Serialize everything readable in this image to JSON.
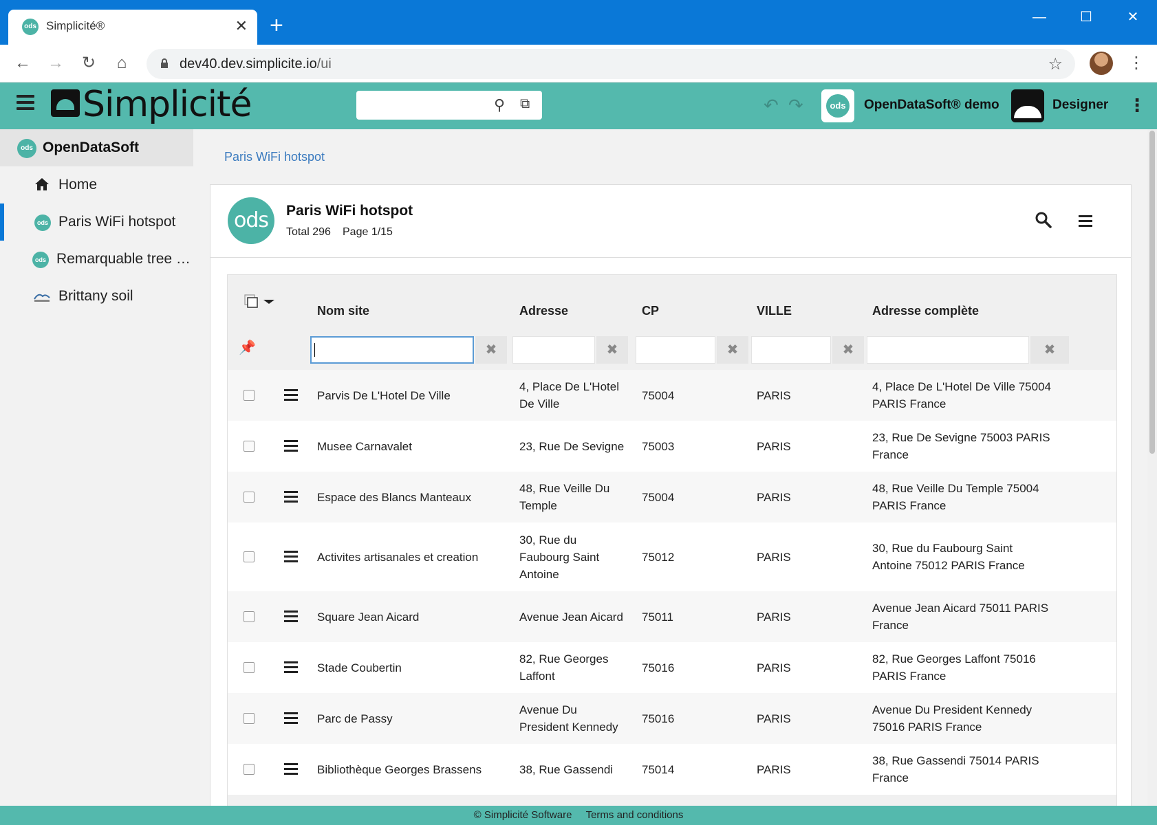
{
  "browser": {
    "tab_title": "Simplicité®",
    "tab_favicon_text": "ods",
    "url_host": "dev40.dev.simplicite.io",
    "url_path": "/ui",
    "colors": {
      "titlebar": "#0a78d7"
    }
  },
  "header": {
    "logo_text": "Simplicité",
    "scope_logo_text": "ods",
    "scope_name": "OpenDataSoft® demo",
    "user_name": "Designer",
    "colors": {
      "accent": "#54b9ad"
    }
  },
  "sidebar": {
    "group_label": "OpenDataSoft",
    "group_icon_text": "ods",
    "items": [
      {
        "label": "Home",
        "icon": "home-icon"
      },
      {
        "label": "Paris WiFi hotspot",
        "icon": "ods-icon",
        "icon_text": "ods",
        "active": true
      },
      {
        "label": "Remarquable tree …",
        "icon": "ods-icon",
        "icon_text": "ods"
      },
      {
        "label": "Brittany soil",
        "icon": "soil-icon"
      }
    ]
  },
  "main": {
    "breadcrumb": "Paris WiFi hotspot",
    "object_logo_text": "ods",
    "title": "Paris WiFi hotspot",
    "total": "Total 296",
    "page": "Page 1/15",
    "columns": [
      "Nom site",
      "Adresse",
      "CP",
      "VILLE",
      "Adresse complète"
    ],
    "filter_clear_glyph": "✖",
    "rows": [
      {
        "nom": "Parvis De L'Hotel De Ville",
        "adresse": [
          "4, Place De L'Hotel",
          "De Ville"
        ],
        "cp": "75004",
        "ville": "PARIS",
        "complete": [
          "4, Place De L'Hotel De Ville 75004",
          "PARIS France"
        ]
      },
      {
        "nom": "Musee Carnavalet",
        "adresse": [
          "23, Rue De Sevigne"
        ],
        "cp": "75003",
        "ville": "PARIS",
        "complete": [
          "23, Rue De Sevigne 75003 PARIS",
          "France"
        ]
      },
      {
        "nom": "Espace des Blancs Manteaux",
        "adresse": [
          "48, Rue Veille Du",
          "Temple"
        ],
        "cp": "75004",
        "ville": "PARIS",
        "complete": [
          "48, Rue Veille Du Temple 75004",
          "PARIS France"
        ]
      },
      {
        "nom": "Activites artisanales et creation",
        "adresse": [
          "30, Rue du",
          "Faubourg Saint",
          "Antoine"
        ],
        "cp": "75012",
        "ville": "PARIS",
        "complete": [
          "30, Rue du Faubourg Saint",
          "Antoine 75012 PARIS France"
        ]
      },
      {
        "nom": "Square Jean Aicard",
        "adresse": [
          "Avenue Jean Aicard"
        ],
        "cp": "75011",
        "ville": "PARIS",
        "complete": [
          "Avenue Jean Aicard 75011 PARIS",
          "France"
        ]
      },
      {
        "nom": "Stade Coubertin",
        "adresse": [
          "82, Rue Georges",
          "Laffont"
        ],
        "cp": "75016",
        "ville": "PARIS",
        "complete": [
          "82, Rue Georges Laffont 75016",
          "PARIS France"
        ]
      },
      {
        "nom": "Parc de Passy",
        "adresse": [
          "Avenue Du",
          "President Kennedy"
        ],
        "cp": "75016",
        "ville": "PARIS",
        "complete": [
          "Avenue Du President Kennedy",
          "75016 PARIS France"
        ]
      },
      {
        "nom": "Bibliothèque Georges Brassens",
        "adresse": [
          "38, Rue Gassendi"
        ],
        "cp": "75014",
        "ville": "PARIS",
        "complete": [
          "38, Rue Gassendi 75014 PARIS",
          "France"
        ]
      }
    ]
  },
  "footer": {
    "copyright": "© Simplicité Software",
    "terms": "Terms and conditions"
  }
}
